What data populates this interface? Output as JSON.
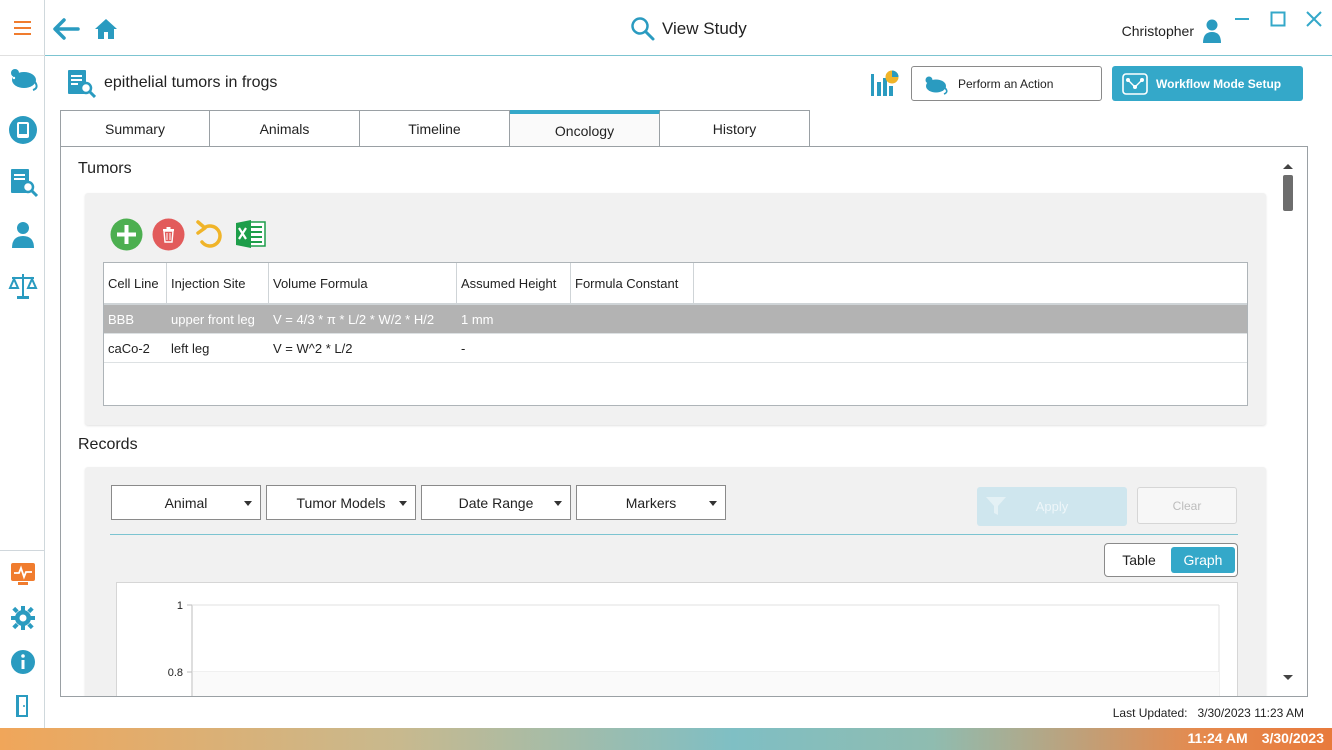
{
  "titlebar": {
    "title": "View Study",
    "user_name": "Christopher"
  },
  "study": {
    "name": "epithelial tumors in frogs"
  },
  "actions": {
    "perform_action": "Perform an Action",
    "workflow_setup": "Workflow Mode Setup"
  },
  "tabs": [
    {
      "label": "Summary"
    },
    {
      "label": "Animals"
    },
    {
      "label": "Timeline"
    },
    {
      "label": "Oncology"
    },
    {
      "label": "History"
    }
  ],
  "tumors": {
    "section_label": "Tumors",
    "columns": [
      "Cell Line",
      "Injection Site",
      "Volume Formula",
      "Assumed Height",
      "Formula Constant"
    ],
    "rows": [
      [
        "BBB",
        "upper front leg",
        "V = 4/3 * π * L/2 * W/2 * H/2",
        "1 mm",
        ""
      ],
      [
        "caCo-2",
        "left leg",
        "V = W^2 * L/2",
        "-",
        ""
      ]
    ]
  },
  "records": {
    "section_label": "Records",
    "filters": [
      "Animal",
      "Tumor Models",
      "Date Range",
      "Markers"
    ],
    "apply_label": "Apply",
    "clear_label": "Clear",
    "view_toggle": {
      "table": "Table",
      "graph": "Graph",
      "selected": "Graph"
    },
    "y_ticks": [
      "1",
      "0.8"
    ]
  },
  "footer": {
    "last_updated_label": "Last Updated:",
    "last_updated_value": "3/30/2023 11:23 AM"
  },
  "taskbar": {
    "time": "11:24 AM",
    "date": "3/30/2023"
  },
  "colors": {
    "accent": "#34a8c9",
    "add": "#4caf50",
    "delete": "#e53935",
    "undo": "#f0b429",
    "excel": "#1e9e4a",
    "rail_icon": "#2a9bc0",
    "rail_alert": "#f07c2e"
  }
}
